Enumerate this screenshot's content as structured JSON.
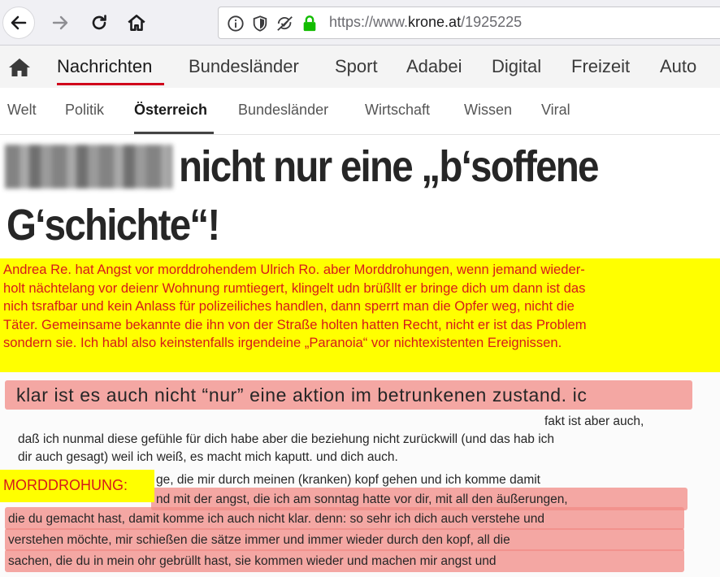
{
  "browser": {
    "icons": {
      "back": "arrow-left-icon",
      "forward": "arrow-right-icon",
      "reload": "reload-icon",
      "home": "home-icon",
      "info": "info-icon",
      "shield": "shield-icon",
      "tracking": "tracking-protection-icon",
      "lock": "lock-icon"
    },
    "url_prefix": "https://www.",
    "url_host": "krone.at",
    "url_path": "/1925225"
  },
  "site": {
    "main_nav": [
      "Nachrichten",
      "Bundesländer",
      "Sport",
      "Adabei",
      "Digital",
      "Freizeit",
      "Auto"
    ],
    "sub_nav": [
      "Welt",
      "Politik",
      "Österreich",
      "Bundesländer",
      "Wirtschaft",
      "Wissen",
      "Viral"
    ],
    "headline_line1": "nicht nur eine „b‘soffene",
    "headline_line2": "G‘schichte“!",
    "accent_color": "#d0021b"
  },
  "annotation": {
    "lines": [
      "Andrea Re. hat Angst vor morddrohendem Ulrich Ro. aber Morddrohungen, wenn jemand wieder-",
      "holt nächtelang vor deienr Wohnung rumtiegert, klingelt udn brüßllt er  bringe dich um dann ist das",
      "nich tsrafbar und kein  Anlass für polizeiliches handlen, dann sperrt man die Opfer weg, nicht die",
      "Täter. Gemeinsame bekannte die ihn von der Straße holten hatten Recht, nicht er ist das Problem",
      "sondern sie. Ich habl also keinstenfalls irgendeine „Paranoia“ vor nichtexistenten Ereignissen."
    ],
    "label": "MORDDROHUNG:",
    "highlight_color": "#ffff00",
    "text_color": "#d61a1a"
  },
  "scan": {
    "line1": "klar ist es auch nicht “nur” eine aktion im betrunkenen zustand. ic",
    "line2": "fakt ist aber auch,",
    "line3": "daß ich nunmal diese gefühle für dich habe aber die beziehung nicht zurückwill (und das hab ich",
    "line4": "dir auch gesagt) weil ich weiß, es macht mich kaputt. und dich auch.",
    "line5": "ge, die mir durch meinen (kranken) kopf gehen und ich komme damit",
    "line6": "nd mit der angst, die ich am sonntag hatte vor dir, mit all den äußerungen,",
    "line7": "die du gemacht hast, damit komme ich auch nicht klar. denn: so sehr ich dich auch verstehe und",
    "line8": "verstehen möchte, mir schießen die sätze immer und immer wieder durch den kopf, all die",
    "line9": "sachen, die du in mein ohr gebrüllt hast, sie kommen wieder und machen mir angst und",
    "highlight_color": "#f28b86"
  }
}
